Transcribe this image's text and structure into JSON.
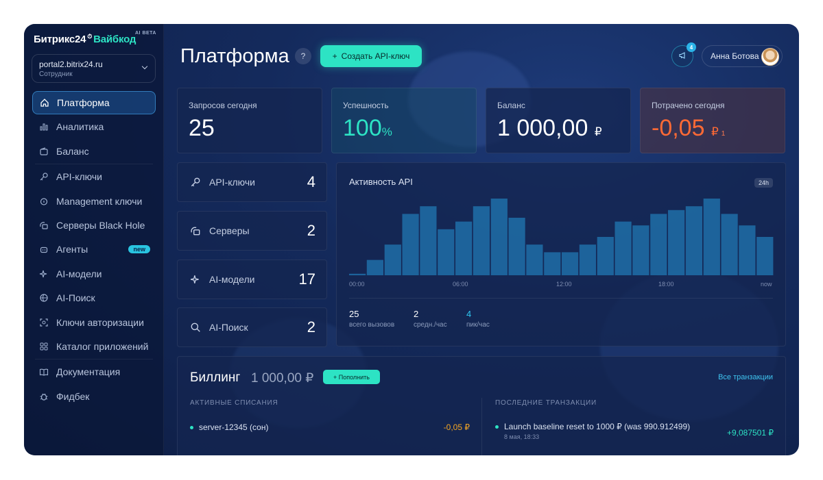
{
  "brand": {
    "name": "Битрикс24",
    "product": "Вайбкод",
    "beta": "AI BETA"
  },
  "portal": {
    "domain": "portal2.bitrix24.ru",
    "role": "Сотрудник"
  },
  "nav": [
    {
      "label": "Платформа",
      "icon": "home-icon",
      "active": true
    },
    {
      "label": "Аналитика",
      "icon": "bar-chart-icon"
    },
    {
      "label": "Баланс",
      "icon": "wallet-icon"
    },
    {
      "label": "API-ключи",
      "icon": "key-icon"
    },
    {
      "label": "Management ключи",
      "icon": "lock-icon"
    },
    {
      "label": "Серверы Black Hole",
      "icon": "server-icon"
    },
    {
      "label": "Агенты",
      "icon": "robot-icon",
      "badge": "new"
    },
    {
      "label": "AI-модели",
      "icon": "sparkle-icon"
    },
    {
      "label": "AI-Поиск",
      "icon": "globe-icon"
    },
    {
      "label": "Ключи авторизации",
      "icon": "face-id-icon"
    },
    {
      "label": "Каталог приложений",
      "icon": "grid-icon"
    },
    {
      "label": "Документация",
      "icon": "book-icon"
    },
    {
      "label": "Фидбек",
      "icon": "bug-icon"
    }
  ],
  "header": {
    "title": "Платформа",
    "help": "?",
    "create_label": "Создать API-ключ",
    "notif_count": "4",
    "user": "Анна Ботова"
  },
  "stats": [
    {
      "label": "Запросов сегодня",
      "value": "25"
    },
    {
      "label": "Успешность",
      "value": "100",
      "unit": "%",
      "color": "#2de3c4"
    },
    {
      "label": "Баланс",
      "value": "1 000,00",
      "unit": "₽"
    },
    {
      "label": "Потрачено сегодня",
      "value": "-0,05",
      "unit": "₽",
      "sub": "1",
      "color": "#ff6a35"
    }
  ],
  "mini": [
    {
      "label": "API-ключи",
      "value": "4",
      "icon": "key-icon"
    },
    {
      "label": "Серверы",
      "value": "2",
      "icon": "server-icon"
    },
    {
      "label": "AI-модели",
      "value": "17",
      "icon": "sparkle-icon"
    },
    {
      "label": "AI-Поиск",
      "value": "2",
      "icon": "search-icon"
    }
  ],
  "chart": {
    "title": "Активность API",
    "range": "24h",
    "ticks": [
      "00:00",
      "06:00",
      "12:00",
      "18:00",
      "now"
    ],
    "stats": [
      {
        "value": "25",
        "label": "всего вызовов"
      },
      {
        "value": "2",
        "label": "средн./час"
      },
      {
        "value": "4",
        "label": "пик/час"
      }
    ]
  },
  "chart_data": {
    "type": "bar",
    "title": "Активность API",
    "values": [
      0.2,
      2.0,
      4.0,
      8.0,
      9.0,
      6.0,
      7.0,
      9.0,
      10.0,
      7.5,
      4.0,
      3.0,
      3.0,
      4.0,
      5.0,
      7.0,
      6.5,
      8.0,
      8.5,
      9.0,
      10.0,
      8.0,
      6.5,
      5.0
    ],
    "ylim": [
      0,
      10
    ],
    "xlabel": "",
    "ylabel": "",
    "grid": false
  },
  "billing": {
    "title": "Биллинг",
    "amount": "1 000,00 ₽",
    "topup": "+ Пополнить",
    "all": "Все транзакции",
    "col_active": "АКТИВНЫЕ СПИСАНИЯ",
    "col_last": "ПОСЛЕДНИЕ ТРАНЗАКЦИИ",
    "active_item": "server-12345 (сон)",
    "active_amount": "-0,05 ₽",
    "tx_title": "Launch baseline reset to 1000 ₽ (was 990.912499)",
    "tx_date": "8 мая, 18:33",
    "tx_amount": "+9,087501 ₽"
  }
}
